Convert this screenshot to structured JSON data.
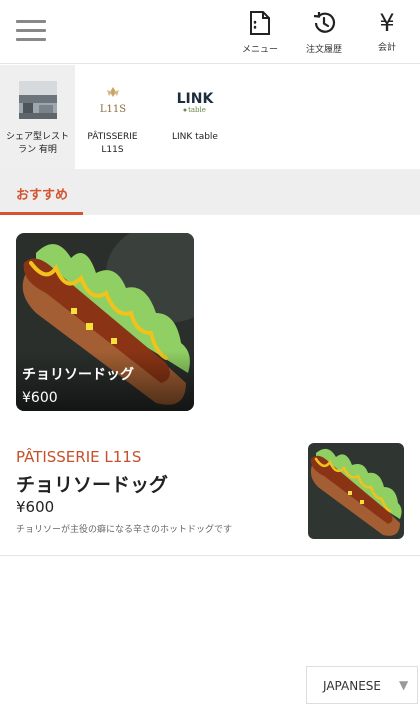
{
  "header": {
    "menu_label": "メニュー",
    "history_label": "注文履歴",
    "checkout_label": "会計",
    "yen_symbol": "¥"
  },
  "stores": [
    {
      "name": "シェア型レストラン 有明",
      "active": true
    },
    {
      "name": "PÂTISSERIE L11S",
      "logo_text": "L11S",
      "active": false
    },
    {
      "name": "LINK table",
      "logo_text": "LINK",
      "logo_sub": "table",
      "active": false
    }
  ],
  "tabs": [
    {
      "label": "おすすめ",
      "active": true
    }
  ],
  "featured": {
    "name": "チョリソードッグ",
    "price": "¥600"
  },
  "items": [
    {
      "store": "PÂTISSERIE L11S",
      "title": "チョリソードッグ",
      "price": "¥600",
      "description": "チョリソーが主役の癖になる辛さのホットドッグです"
    }
  ],
  "language": {
    "selected": "JAPANESE"
  },
  "colors": {
    "accent": "#d25530",
    "tab_bg": "#eeeeee",
    "active_store_bg": "#efefef"
  }
}
